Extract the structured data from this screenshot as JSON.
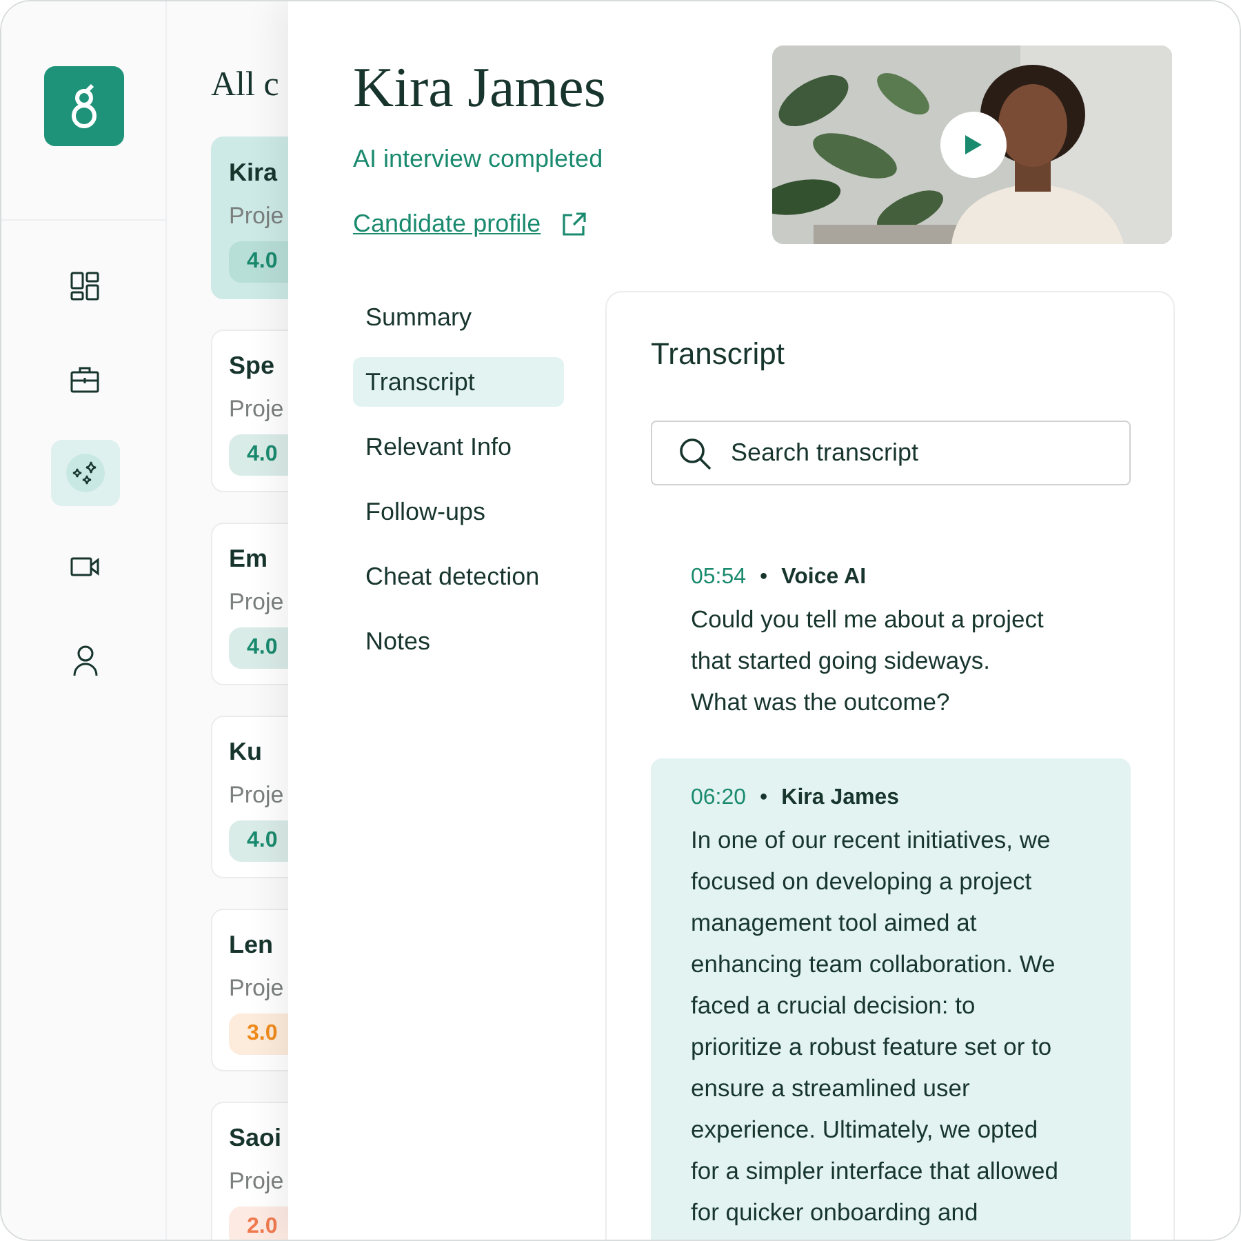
{
  "rail": {
    "items": [
      {
        "kind": "dashboard",
        "selected": false
      },
      {
        "kind": "briefcase",
        "selected": false
      },
      {
        "kind": "sparkles",
        "selected": true
      },
      {
        "kind": "video",
        "selected": false
      },
      {
        "kind": "person",
        "selected": false
      }
    ]
  },
  "candidates": {
    "title": "All c",
    "items": [
      {
        "name": "Kira",
        "subtitle": "Proje",
        "score": "4.0",
        "color": "#1a8a6e",
        "selected": true
      },
      {
        "name": "Spe",
        "subtitle": "Proje",
        "score": "4.0",
        "color": "#1a8a6e",
        "selected": false
      },
      {
        "name": "Em",
        "subtitle": "Proje",
        "score": "4.0",
        "color": "#1a8a6e",
        "selected": false
      },
      {
        "name": "Ku",
        "subtitle": "Proje",
        "score": "4.0",
        "color": "#1a8a6e",
        "selected": false
      },
      {
        "name": "Len",
        "subtitle": "Proje",
        "score": "3.0",
        "color": "#f08a1c",
        "selected": false
      },
      {
        "name": "Saoi",
        "subtitle": "Proje",
        "score": "2.0",
        "color": "#f07a50",
        "selected": false
      }
    ]
  },
  "detail": {
    "name": "Kira James",
    "status": "AI interview completed",
    "profile_link": "Candidate profile",
    "sections": [
      {
        "label": "Summary",
        "selected": false
      },
      {
        "label": "Transcript",
        "selected": true
      },
      {
        "label": "Relevant Info",
        "selected": false
      },
      {
        "label": "Follow-ups",
        "selected": false
      },
      {
        "label": "Cheat detection",
        "selected": false
      },
      {
        "label": "Notes",
        "selected": false
      }
    ],
    "transcript": {
      "title": "Transcript",
      "search": {
        "placeholder": "Search transcript"
      },
      "entries": [
        {
          "time": "05:54",
          "separator": "•",
          "speaker": "Voice AI",
          "text": "Could you tell me about a project\nthat started going sideways.\nWhat was the outcome?",
          "highlighted": false
        },
        {
          "time": "06:20",
          "separator": "•",
          "speaker": "Kira James",
          "text": "In one of our recent initiatives, we\nfocused on developing a project\nmanagement tool aimed at\nenhancing team collaboration. We\nfaced a crucial decision: to\nprioritize a robust feature set or to\nensure a streamlined user\nexperience. Ultimately, we opted\nfor a simpler interface that allowed\nfor quicker onboarding and",
          "highlighted": true
        }
      ]
    }
  }
}
